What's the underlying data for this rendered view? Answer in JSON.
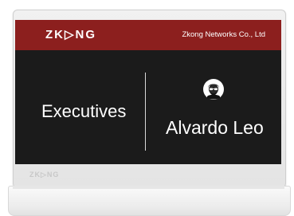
{
  "header": {
    "brand": "ZK▷NG",
    "company": "Zkong Networks Co., Ltd"
  },
  "display": {
    "title": "Executives",
    "name": "Alvardo Leo",
    "avatar_icon": "user-avatar-icon"
  },
  "bezel": {
    "brand": "ZK▷NG"
  },
  "colors": {
    "header_bg": "#8c1f1e",
    "screen_bg": "#1b1b1b",
    "text": "#ffffff"
  }
}
